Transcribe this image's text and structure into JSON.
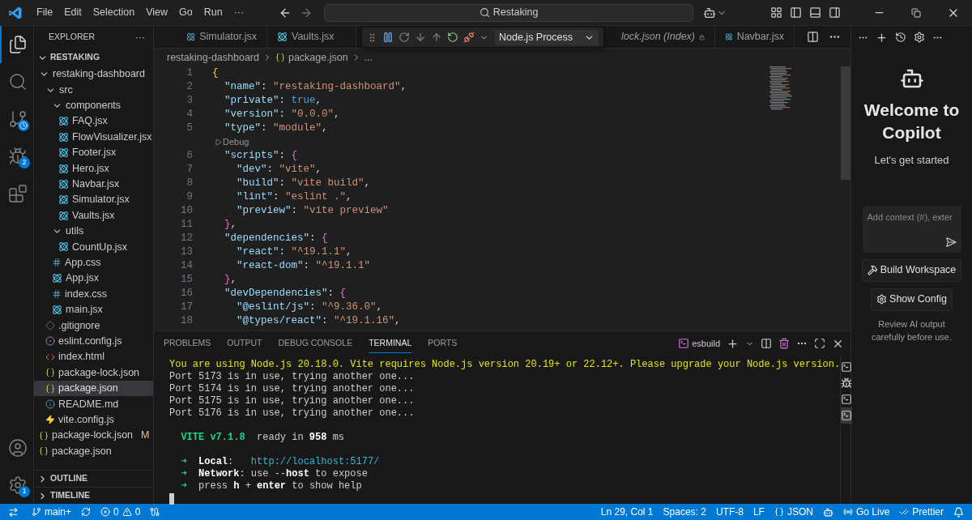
{
  "title_bar": {
    "menus": [
      "File",
      "Edit",
      "Selection",
      "View",
      "Go",
      "Run",
      "···"
    ],
    "search": "Restaking"
  },
  "activity_bar": {
    "top": [
      {
        "kind": "files",
        "selected": true
      },
      {
        "kind": "search",
        "selected": false
      },
      {
        "kind": "source-control",
        "selected": false
      },
      {
        "kind": "run",
        "selected": false,
        "badge": "2"
      },
      {
        "kind": "extensions",
        "selected": false
      }
    ],
    "bottom": [
      {
        "kind": "account"
      },
      {
        "kind": "settings",
        "badge": "1"
      }
    ]
  },
  "explorer": {
    "title": "EXPLORER",
    "more": "···",
    "root": {
      "label": "RESTAKING",
      "expanded": true,
      "children": [
        {
          "kind": "folder",
          "label": "restaking-dashboard",
          "expanded": true,
          "selected": false,
          "children": [
            {
              "kind": "folder",
              "label": "src",
              "expanded": true,
              "selected": false,
              "children": [
                {
                  "kind": "folder",
                  "label": "components",
                  "expanded": true,
                  "selected": false,
                  "children": [
                    {
                      "kind": "react",
                      "label": "FAQ.jsx",
                      "selected": false
                    },
                    {
                      "kind": "react",
                      "label": "FlowVisualizer.jsx",
                      "selected": false
                    },
                    {
                      "kind": "react",
                      "label": "Footer.jsx",
                      "selected": false
                    },
                    {
                      "kind": "react",
                      "label": "Hero.jsx",
                      "selected": false
                    },
                    {
                      "kind": "react",
                      "label": "Navbar.jsx",
                      "selected": false
                    },
                    {
                      "kind": "react",
                      "label": "Simulator.jsx",
                      "selected": false
                    },
                    {
                      "kind": "react",
                      "label": "Vaults.jsx",
                      "selected": false
                    }
                  ]
                },
                {
                  "kind": "folder",
                  "label": "utils",
                  "expanded": true,
                  "selected": false,
                  "children": [
                    {
                      "kind": "react",
                      "label": "CountUp.jsx",
                      "selected": false
                    }
                  ]
                },
                {
                  "kind": "css",
                  "label": "App.css",
                  "selected": false
                },
                {
                  "kind": "react",
                  "label": "App.jsx",
                  "selected": false
                },
                {
                  "kind": "css",
                  "label": "index.css",
                  "selected": false
                },
                {
                  "kind": "react",
                  "label": "main.jsx",
                  "selected": false
                }
              ]
            },
            {
              "kind": "git",
              "label": ".gitignore",
              "selected": false
            },
            {
              "kind": "eslint",
              "label": "eslint.config.js",
              "selected": false
            },
            {
              "kind": "html",
              "label": "index.html",
              "selected": false
            },
            {
              "kind": "json",
              "label": "package-lock.json",
              "selected": false
            },
            {
              "kind": "json",
              "label": "package.json",
              "selected": true
            },
            {
              "kind": "info",
              "label": "README.md",
              "selected": false
            },
            {
              "kind": "vite",
              "label": "vite.config.js",
              "selected": false
            }
          ]
        },
        {
          "kind": "json",
          "label": "package-lock.json",
          "selected": false,
          "badge": "M"
        },
        {
          "kind": "json",
          "label": "package.json",
          "selected": false
        }
      ]
    },
    "sections": [
      {
        "label": "OUTLINE",
        "expanded": false
      },
      {
        "label": "TIMELINE",
        "expanded": false
      }
    ]
  },
  "editor_tabs": [
    {
      "label": "Simulator.jsx",
      "kind": "react",
      "selected": false
    },
    {
      "label": "Vaults.jsx",
      "kind": "react",
      "selected": false
    },
    {
      "label": "lock.json (Index)",
      "kind": "locked",
      "selected": false
    },
    {
      "label": "Navbar.jsx",
      "kind": "react",
      "selected": false
    }
  ],
  "debug_toolbar": {
    "target": "Node.js Process"
  },
  "breadcrumb": [
    "restaking-dashboard",
    "package.json",
    "..."
  ],
  "code": [
    {
      "number": "1",
      "tokens": [
        {
          "kind": "brace1",
          "text": "{"
        }
      ]
    },
    {
      "number": "2",
      "tokens": [
        {
          "kind": "key",
          "text": "  \"name\""
        },
        {
          "kind": "punct",
          "text": ": "
        },
        {
          "kind": "string",
          "text": "\"restaking-dashboard\""
        },
        {
          "kind": "punct",
          "text": ","
        }
      ]
    },
    {
      "number": "3",
      "tokens": [
        {
          "kind": "key",
          "text": "  \"private\""
        },
        {
          "kind": "punct",
          "text": ": "
        },
        {
          "kind": "bool",
          "text": "true"
        },
        {
          "kind": "punct",
          "text": ","
        }
      ]
    },
    {
      "number": "4",
      "tokens": [
        {
          "kind": "key",
          "text": "  \"version\""
        },
        {
          "kind": "punct",
          "text": ": "
        },
        {
          "kind": "string",
          "text": "\"0.0.0\""
        },
        {
          "kind": "punct",
          "text": ","
        }
      ]
    },
    {
      "number": "5",
      "tokens": [
        {
          "kind": "key",
          "text": "  \"type\""
        },
        {
          "kind": "punct",
          "text": ": "
        },
        {
          "kind": "string",
          "text": "\"module\""
        },
        {
          "kind": "punct",
          "text": ","
        }
      ]
    },
    {
      "kind": "codelens",
      "text": "Debug"
    },
    {
      "number": "6",
      "tokens": [
        {
          "kind": "key",
          "text": "  \"scripts\""
        },
        {
          "kind": "punct",
          "text": ": "
        },
        {
          "kind": "brace2",
          "text": "{"
        }
      ]
    },
    {
      "number": "7",
      "tokens": [
        {
          "kind": "key",
          "text": "    \"dev\""
        },
        {
          "kind": "punct",
          "text": ": "
        },
        {
          "kind": "string",
          "text": "\"vite\""
        },
        {
          "kind": "punct",
          "text": ","
        }
      ]
    },
    {
      "number": "8",
      "tokens": [
        {
          "kind": "key",
          "text": "    \"build\""
        },
        {
          "kind": "punct",
          "text": ": "
        },
        {
          "kind": "string",
          "text": "\"vite build\""
        },
        {
          "kind": "punct",
          "text": ","
        }
      ]
    },
    {
      "number": "9",
      "tokens": [
        {
          "kind": "key",
          "text": "    \"lint\""
        },
        {
          "kind": "punct",
          "text": ": "
        },
        {
          "kind": "string",
          "text": "\"eslint .\""
        },
        {
          "kind": "punct",
          "text": ","
        }
      ]
    },
    {
      "number": "10",
      "tokens": [
        {
          "kind": "key",
          "text": "    \"preview\""
        },
        {
          "kind": "punct",
          "text": ": "
        },
        {
          "kind": "string",
          "text": "\"vite preview\""
        }
      ]
    },
    {
      "number": "11",
      "tokens": [
        {
          "kind": "brace2",
          "text": "  }"
        },
        {
          "kind": "punct",
          "text": ","
        }
      ]
    },
    {
      "number": "12",
      "tokens": [
        {
          "kind": "key",
          "text": "  \"dependencies\""
        },
        {
          "kind": "punct",
          "text": ": "
        },
        {
          "kind": "brace2",
          "text": "{"
        }
      ]
    },
    {
      "number": "13",
      "tokens": [
        {
          "kind": "key",
          "text": "    \"react\""
        },
        {
          "kind": "punct",
          "text": ": "
        },
        {
          "kind": "string",
          "text": "\"^19.1.1\""
        },
        {
          "kind": "punct",
          "text": ","
        }
      ]
    },
    {
      "number": "14",
      "tokens": [
        {
          "kind": "key",
          "text": "    \"react-dom\""
        },
        {
          "kind": "punct",
          "text": ": "
        },
        {
          "kind": "string",
          "text": "\"^19.1.1\""
        }
      ]
    },
    {
      "number": "15",
      "tokens": [
        {
          "kind": "brace2",
          "text": "  }"
        },
        {
          "kind": "punct",
          "text": ","
        }
      ]
    },
    {
      "number": "16",
      "tokens": [
        {
          "kind": "key",
          "text": "  \"devDependencies\""
        },
        {
          "kind": "punct",
          "text": ": "
        },
        {
          "kind": "brace2",
          "text": "{"
        }
      ]
    },
    {
      "number": "17",
      "tokens": [
        {
          "kind": "key",
          "text": "    \"@eslint/js\""
        },
        {
          "kind": "punct",
          "text": ": "
        },
        {
          "kind": "string",
          "text": "\"^9.36.0\""
        },
        {
          "kind": "punct",
          "text": ","
        }
      ]
    },
    {
      "number": "18",
      "tokens": [
        {
          "kind": "key",
          "text": "    \"@types/react\""
        },
        {
          "kind": "punct",
          "text": ": "
        },
        {
          "kind": "string",
          "text": "\"^19.1.16\""
        },
        {
          "kind": "punct",
          "text": ","
        }
      ]
    }
  ],
  "panel": {
    "tabs": [
      {
        "label": "PROBLEMS",
        "selected": false
      },
      {
        "label": "OUTPUT",
        "selected": false
      },
      {
        "label": "DEBUG CONSOLE",
        "selected": false
      },
      {
        "label": "TERMINAL",
        "selected": true
      },
      {
        "label": "PORTS",
        "selected": false
      }
    ],
    "terminal_name": "esbuild",
    "instances": [
      {
        "kind": "terminal",
        "selected": false
      },
      {
        "kind": "debug",
        "selected": false
      },
      {
        "kind": "terminal",
        "selected": false
      },
      {
        "kind": "terminal",
        "selected": true
      }
    ],
    "lines": [
      {
        "kind": "text",
        "segments": [
          {
            "kind": "warn",
            "text": "You are using Node.js 20.18.0. Vite requires Node.js version 20.19+ or 22.12+. Please upgrade your Node.js version."
          }
        ]
      },
      {
        "kind": "text",
        "segments": [
          {
            "kind": "plain",
            "text": "Port 5173 is in use, trying another one..."
          }
        ]
      },
      {
        "kind": "text",
        "segments": [
          {
            "kind": "plain",
            "text": "Port 5174 is in use, trying another one..."
          }
        ]
      },
      {
        "kind": "text",
        "segments": [
          {
            "kind": "plain",
            "text": "Port 5175 is in use, trying another one..."
          }
        ]
      },
      {
        "kind": "text",
        "segments": [
          {
            "kind": "plain",
            "text": "Port 5176 is in use, trying another one..."
          }
        ]
      },
      {
        "kind": "blank"
      },
      {
        "kind": "text",
        "segments": [
          {
            "kind": "green",
            "text": "  VITE v7.1.8"
          },
          {
            "kind": "plain",
            "text": "  ready in "
          },
          {
            "kind": "bold",
            "text": "958"
          },
          {
            "kind": "plain",
            "text": " ms"
          }
        ]
      },
      {
        "kind": "blank"
      },
      {
        "kind": "text",
        "segments": [
          {
            "kind": "arrow",
            "text": "  ➜  "
          },
          {
            "kind": "bold",
            "text": "Local"
          },
          {
            "kind": "plain",
            "text": ":   "
          },
          {
            "kind": "link",
            "text": "http://localhost:5177/"
          }
        ]
      },
      {
        "kind": "text",
        "segments": [
          {
            "kind": "arrow",
            "text": "  ➜  "
          },
          {
            "kind": "bold",
            "text": "Network"
          },
          {
            "kind": "plain",
            "text": ": use --"
          },
          {
            "kind": "bold",
            "text": "host"
          },
          {
            "kind": "plain",
            "text": " to expose"
          }
        ]
      },
      {
        "kind": "text",
        "segments": [
          {
            "kind": "arrow",
            "text": "  ➜"
          },
          {
            "kind": "plain",
            "text": "  press "
          },
          {
            "kind": "bold",
            "text": "h"
          },
          {
            "kind": "plain",
            "text": " + "
          },
          {
            "kind": "bold",
            "text": "enter"
          },
          {
            "kind": "plain",
            "text": " to show help"
          }
        ]
      },
      {
        "kind": "cursor"
      }
    ]
  },
  "copilot": {
    "title": "Welcome to Copilot",
    "subtitle": "Let's get started",
    "placeholder": "Add context (#), exter",
    "buttons": [
      {
        "kind": "build",
        "label": "Build Workspace"
      },
      {
        "kind": "config",
        "label": "Show Config"
      }
    ],
    "note": "Review AI output carefully before use."
  },
  "status_bar": {
    "left": [
      {
        "kind": "remote"
      },
      {
        "kind": "branch",
        "text": "main+"
      },
      {
        "kind": "sync"
      },
      {
        "kind": "problems",
        "errors": "0",
        "warnings": "0"
      },
      {
        "kind": "ports"
      }
    ],
    "right": [
      {
        "kind": "text",
        "text": "Ln 29, Col 1"
      },
      {
        "kind": "text",
        "text": "Spaces: 2"
      },
      {
        "kind": "text",
        "text": "UTF-8"
      },
      {
        "kind": "text",
        "text": "LF"
      },
      {
        "kind": "language",
        "text": "JSON"
      },
      {
        "kind": "copilot"
      },
      {
        "kind": "golive",
        "text": "Go Live"
      },
      {
        "kind": "prettier",
        "text": "Prettier"
      },
      {
        "kind": "bell"
      }
    ]
  }
}
